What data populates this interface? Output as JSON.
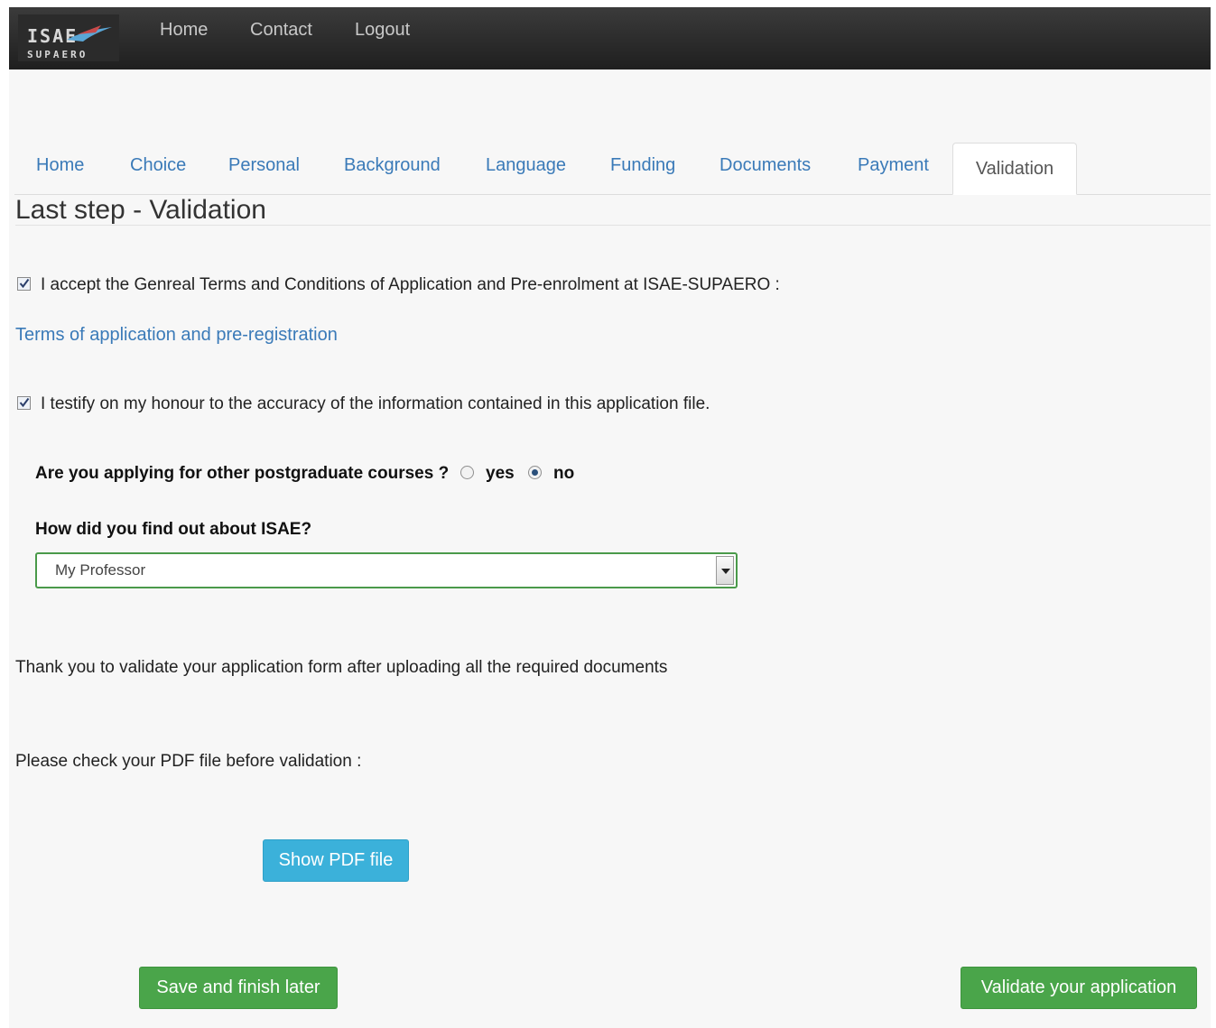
{
  "navbar": {
    "logo_top": "ISAE",
    "logo_bottom": "SUPAERO",
    "links": [
      "Home",
      "Contact",
      "Logout"
    ]
  },
  "tabs": [
    "Home",
    "Choice",
    "Personal",
    "Background",
    "Language",
    "Funding",
    "Documents",
    "Payment",
    "Validation"
  ],
  "active_tab": "Validation",
  "page_title": "Last step - Validation",
  "terms_checkbox": {
    "label": "I accept the Genreal Terms and Conditions of Application and Pre-enrolment at ISAE-SUPAERO :",
    "checked": true
  },
  "terms_link": "Terms of application and pre-registration",
  "honour_checkbox": {
    "label": "I testify on my honour to the accuracy of the information contained in this application file.",
    "checked": true
  },
  "other_courses": {
    "question": "Are you applying for other postgraduate courses ?",
    "options": [
      "yes",
      "no"
    ],
    "selected": "no"
  },
  "find_out": {
    "question": "How did you find out about ISAE?",
    "selected": "My Professor"
  },
  "validate_note": "Thank you to validate your application form after uploading all the required documents",
  "pdf_note": "Please check your PDF file before validation :",
  "buttons": {
    "show_pdf": "Show PDF file",
    "save_later": "Save and finish later",
    "validate": "Validate your application"
  },
  "colors": {
    "link": "#3a7ab8",
    "info_button": "#3bb1da",
    "success_button": "#4aa54a",
    "navbar": "#2b2b2b"
  }
}
